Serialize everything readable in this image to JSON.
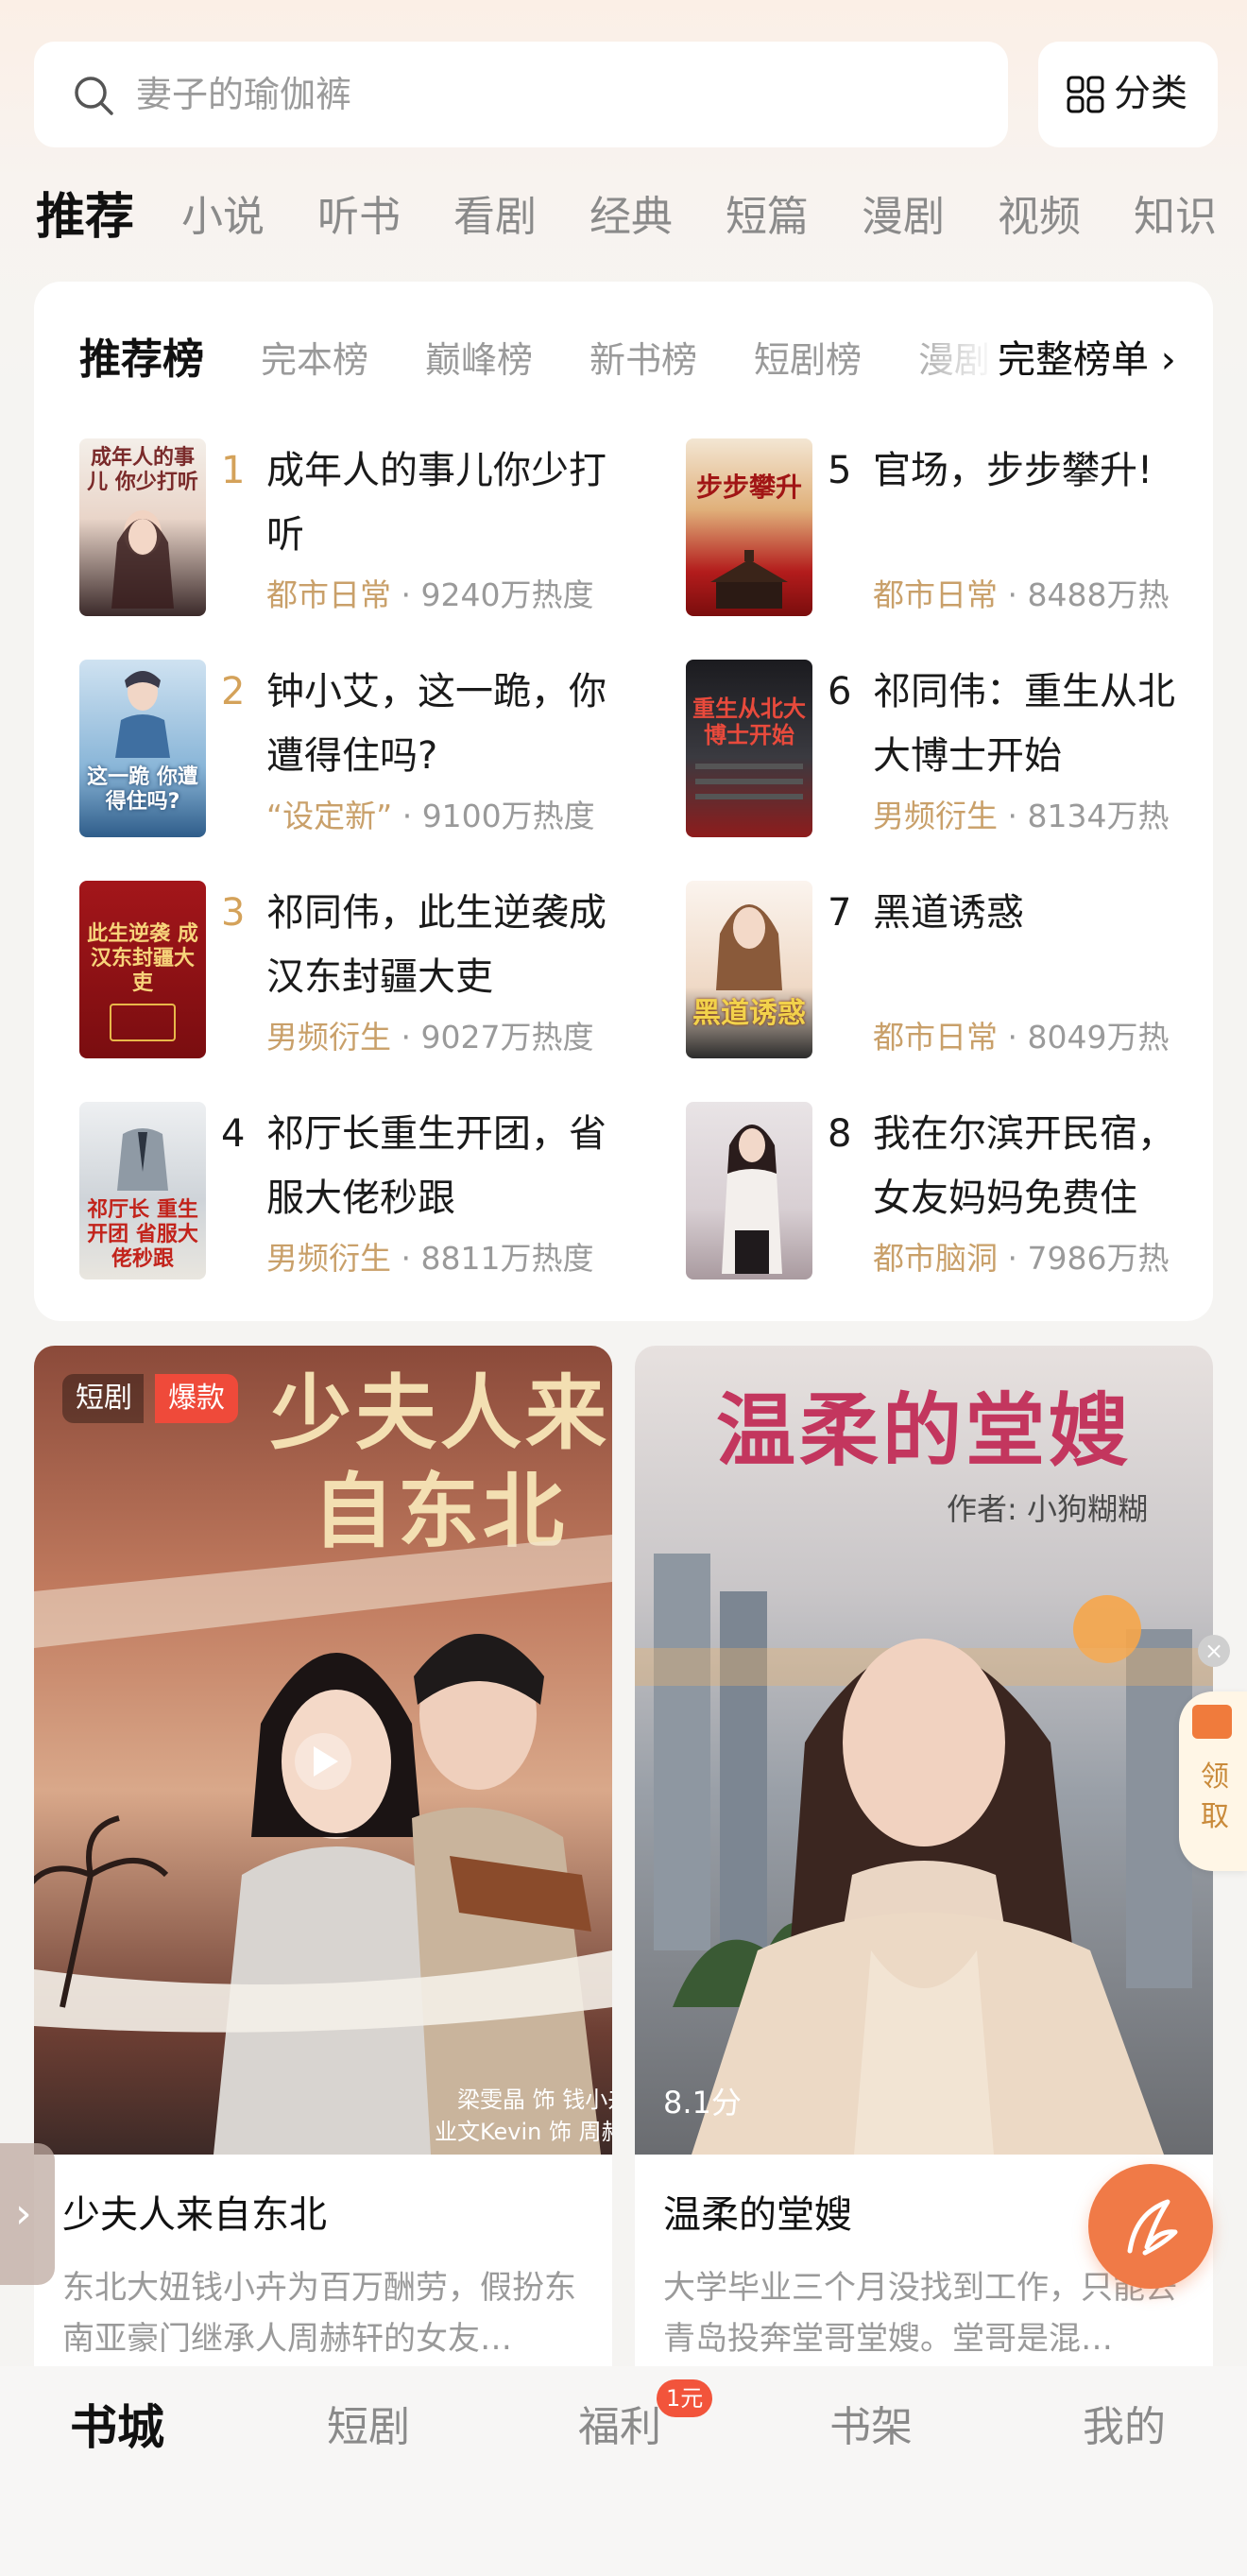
{
  "search": {
    "placeholder_text": "妻子的瑜伽裤",
    "category_label": "分类"
  },
  "tabs": [
    "推荐",
    "小说",
    "听书",
    "看剧",
    "经典",
    "短篇",
    "漫剧",
    "视频",
    "知识"
  ],
  "ranking": {
    "tabs": [
      "推荐榜",
      "完本榜",
      "巅峰榜",
      "新书榜",
      "短剧榜",
      "漫剧"
    ],
    "more_label": "完整榜单 ›",
    "books": [
      {
        "rank": "1",
        "title": "成年人的事儿你少打听",
        "genre": "都市日常",
        "heat": "9240万热度",
        "cover_text": "成年人的事儿 你少打听"
      },
      {
        "rank": "2",
        "title": "钟小艾，这一跪，你遭得住吗?",
        "genre": "“设定新”",
        "heat": "9100万热度",
        "cover_text": "这一跪 你遭得住吗?"
      },
      {
        "rank": "3",
        "title": "祁同伟，此生逆袭成汉东封疆大吏",
        "genre": "男频衍生",
        "heat": "9027万热度",
        "cover_text": "此生逆袭 成汉东封疆大吏"
      },
      {
        "rank": "4",
        "title": "祁厅长重生开团，省服大佬秒跟",
        "genre": "男频衍生",
        "heat": "8811万热度",
        "cover_text": "祁厅长 重生开团 省服大佬秒跟"
      },
      {
        "rank": "5",
        "title": "官场，步步攀升!",
        "genre": "都市日常",
        "heat": "8488万热",
        "cover_text": "步步攀升"
      },
      {
        "rank": "6",
        "title": "祁同伟：重生从北大博士开始",
        "genre": "男频衍生",
        "heat": "8134万热",
        "cover_text": "重生从北大 博士开始"
      },
      {
        "rank": "7",
        "title": "黑道诱惑",
        "genre": "都市日常",
        "heat": "8049万热",
        "cover_text": "黑道诱惑"
      },
      {
        "rank": "8",
        "title": "我在尔滨开民宿，女友妈妈免费住",
        "genre": "都市脑洞",
        "heat": "7986万热",
        "cover_text": ""
      }
    ]
  },
  "feed": [
    {
      "tag_type": "短剧",
      "tag_hot": "爆款",
      "poster_title": "少夫人来自东北",
      "cast_line1": "梁雯晶 饰 钱小卉",
      "cast_line2": "业文Kevin 饰 周赫轩",
      "title": "少夫人来自东北",
      "desc": "东北大妞钱小卉为百万酬劳，假扮东南亚豪门继承人周赫轩的女友…"
    },
    {
      "poster_title": "温柔的堂嫂",
      "poster_author": "作者: 小狗糊糊",
      "score": "8.1分",
      "title": "温柔的堂嫂",
      "desc": "大学毕业三个月没找到工作，只能去青岛投奔堂哥堂嫂。堂哥是混…"
    }
  ],
  "floating": {
    "claim_label": "领取",
    "close_glyph": "×",
    "side_chevron": "›"
  },
  "nav": {
    "items": [
      "书城",
      "短剧",
      "福利",
      "书架",
      "我的"
    ],
    "badge": "1元"
  },
  "colors": {
    "accent_orange": "#f07a47",
    "rank_gold": "#d4a25a",
    "genre_tan": "#c9a06a",
    "hot_red": "#ef4a3a"
  }
}
